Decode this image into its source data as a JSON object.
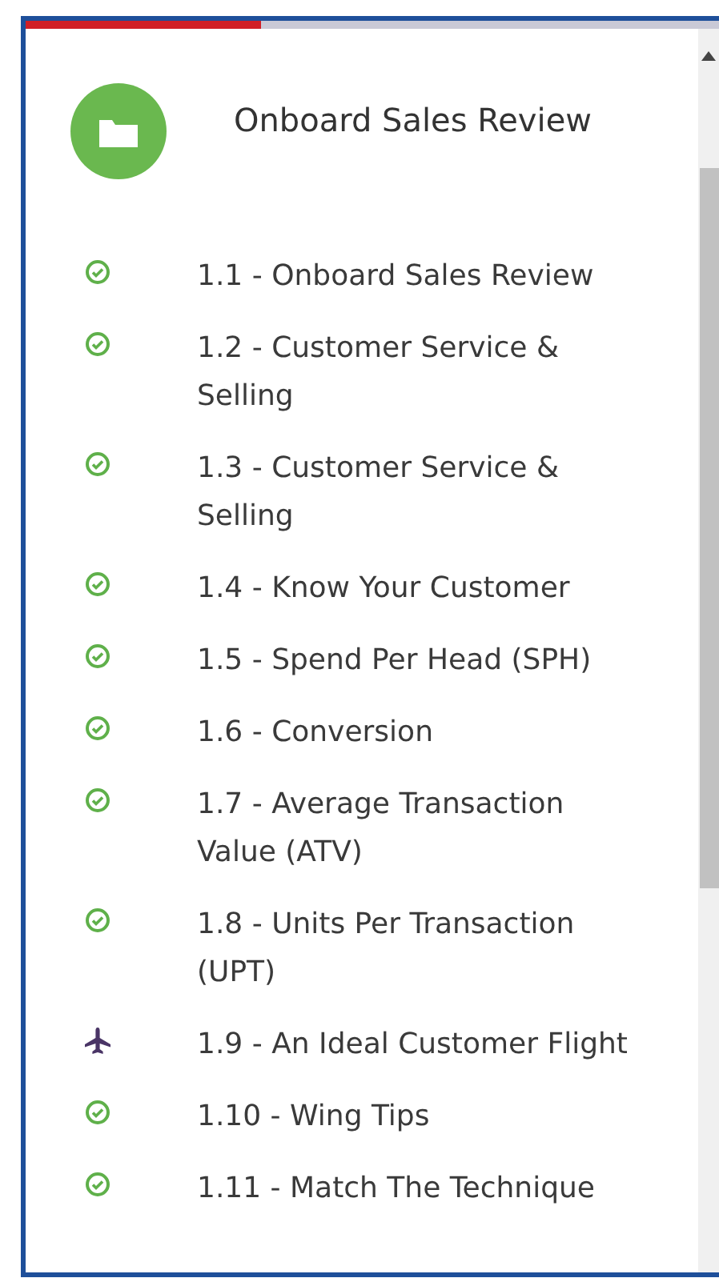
{
  "progress": {
    "level": 0.34
  },
  "header": {
    "title": "Onboard Sales Review"
  },
  "lessons": [
    {
      "label": "1.1 - Onboard Sales Review",
      "kind": "complete"
    },
    {
      "label": "1.2 - Customer Service & Selling",
      "kind": "complete"
    },
    {
      "label": "1.3 - Customer Service & Selling",
      "kind": "complete"
    },
    {
      "label": "1.4 - Know Your Customer",
      "kind": "complete"
    },
    {
      "label": "1.5 - Spend Per Head (SPH)",
      "kind": "complete"
    },
    {
      "label": "1.6 - Conversion",
      "kind": "complete"
    },
    {
      "label": "1.7 - Average Transaction Value (ATV)",
      "kind": "complete"
    },
    {
      "label": "1.8 - Units Per Transaction (UPT)",
      "kind": "complete"
    },
    {
      "label": "1.9 - An Ideal Customer Flight",
      "kind": "current"
    },
    {
      "label": "1.10 - Wing Tips",
      "kind": "complete"
    },
    {
      "label": "1.11 - Match The Technique",
      "kind": "complete"
    }
  ]
}
